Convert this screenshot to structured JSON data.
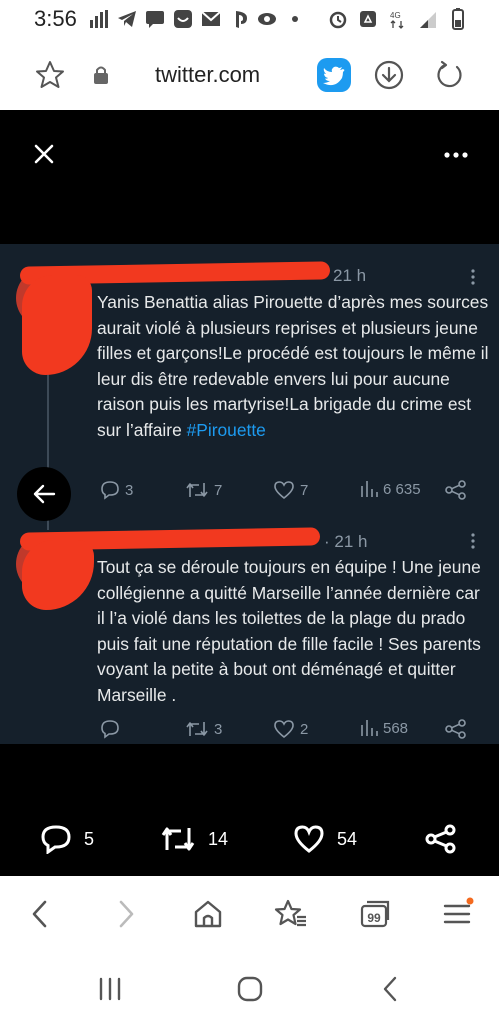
{
  "status_bar": {
    "time": "3:56",
    "network": "4G"
  },
  "browser": {
    "url": "twitter.com"
  },
  "tweets": [
    {
      "time": "21 h",
      "text": "Yanis Benattia alias Pirouette d’après mes sources aurait violé à plusieurs reprises et plusieurs jeune filles et garçons!Le procédé est toujours le même il leur dis être redevable envers lui pour aucune raison puis les martyrise!La brigade du crime est sur l’affaire ",
      "hashtag": "#Pirouette",
      "replies": "3",
      "retweets": "7",
      "likes": "7",
      "views": "6 635"
    },
    {
      "time": "21 h",
      "text": "Tout ça se déroule toujours en équipe ! Une jeune collégienne a quitté Marseille l’année dernière car il l’a violé dans les toilettes de la plage du prado puis fait une réputation de fille facile ! Ses parents voyant la petite à bout ont déménagé et quitter Marseille .",
      "replies": "",
      "retweets": "3",
      "likes": "2",
      "views": "568"
    }
  ],
  "bottom_actions": {
    "replies": "5",
    "retweets": "14",
    "likes": "54"
  },
  "browser_nav": {
    "tabs_count": "99"
  },
  "colors": {
    "panel_bg": "#15202b",
    "text": "#e7e9ea",
    "muted": "#8b98a5",
    "hashtag": "#1d9bf0",
    "redaction": "#f2391f",
    "twitter_blue": "#1d9bf0"
  }
}
